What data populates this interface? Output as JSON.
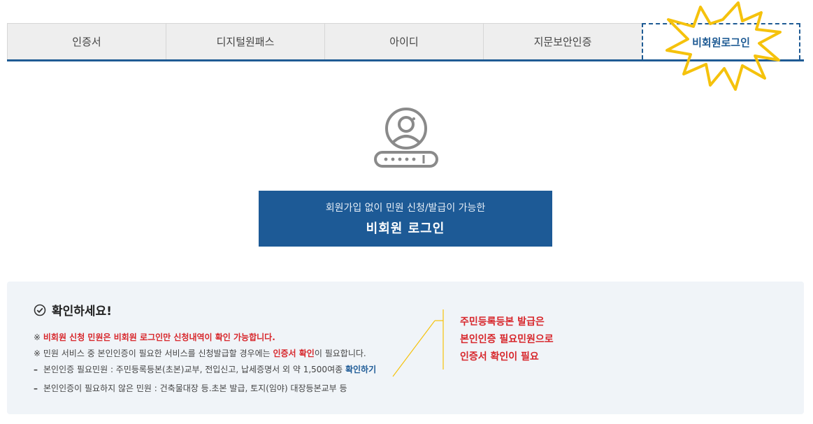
{
  "tabs": [
    {
      "label": "인증서"
    },
    {
      "label": "디지털원패스"
    },
    {
      "label": "아이디"
    },
    {
      "label": "지문보안인증"
    },
    {
      "label": "비회원로그인"
    }
  ],
  "icon": "user-login-key-icon",
  "login_button": {
    "sub": "회원가입 없이 민원 신청/발급이 가능한",
    "main": "비회원 로그인"
  },
  "notice": {
    "title": "확인하세요!",
    "line1": {
      "prefix": "※ ",
      "text": "비회원 신청 민원은 비회원 로그인만 신청내역이 확인 가능합니다."
    },
    "line2": {
      "prefix": "※ 민원 서비스 중 본인인증이 필요한 서비스를 신청발급할 경우에는 ",
      "highlight": "인증서 확인",
      "suffix": "이 필요합니다."
    },
    "line3": {
      "dash": "–",
      "text": "본인인증 필요민원 : 주민등록등본(초본)교부, 전입신고, 납세증명서 외 약 1,500여종 ",
      "link": "확인하기"
    },
    "line4": {
      "dash": "–",
      "text": "본인인증이 필요하지 않은 민원 : 건축물대장 등.초본 발급, 토지(임야) 대장등본교부 등"
    }
  },
  "callout": {
    "line1": "주민등록등본 발급은",
    "line2": "본인인증 필요민원으로",
    "line3": "인증서 확인이 필요"
  },
  "colors": {
    "accent": "#1d5a96",
    "highlight": "#d7262b",
    "burst": "#f5c20c"
  }
}
